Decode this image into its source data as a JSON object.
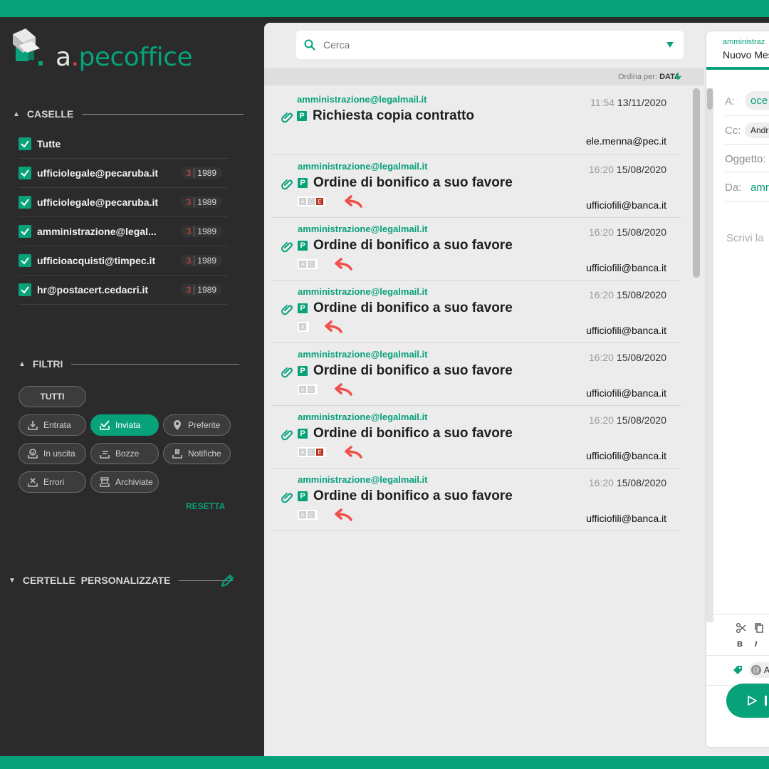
{
  "app": {
    "logo_a": "a",
    "logo_dot": ".",
    "logo_name": "pecoffice"
  },
  "sidebar": {
    "caselle_title": "CASELLE",
    "all_label": "Tutte",
    "mailboxes": [
      {
        "name": "ufficiolegale@pecaruba.it",
        "unread": "3",
        "total": "1989"
      },
      {
        "name": "ufficiolegale@pecaruba.it",
        "unread": "3",
        "total": "1989"
      },
      {
        "name": "amministrazione@legal...",
        "unread": "3",
        "total": "1989"
      },
      {
        "name": "ufficioacquisti@timpec.it",
        "unread": "3",
        "total": "1989"
      },
      {
        "name": "hr@postacert.cedacri.it",
        "unread": "3",
        "total": "1989"
      }
    ],
    "filtri_title": "FILTRI",
    "filters": {
      "tutti": "TUTTI",
      "entrata": "Entrata",
      "inviata": "Inviata",
      "preferite": "Preferite",
      "in_uscita": "In uscita",
      "bozze": "Bozze",
      "notifiche": "Notifiche",
      "errori": "Errori",
      "archiviate": "Archiviate"
    },
    "reset_label": "RESETTA",
    "custom_title": "CERTELLE  PERSONALIZZATE"
  },
  "list": {
    "search_placeholder": "Cerca",
    "sort_label": "Ordina per:",
    "sort_value": "DATA",
    "messages": [
      {
        "from": "amministrazione@legalmail.it",
        "time": "11:54",
        "date": "13/11/2020",
        "subject": "Richiesta copia contratto",
        "to": "ele.menna@pec.it"
      },
      {
        "from": "amministrazione@legalmail.it",
        "time": "16:20",
        "date": "15/08/2020",
        "subject": "Ordine di bonifico a suo favore",
        "to": "ufficiofili@banca.it",
        "tag_a": "A",
        "tag_c": "C",
        "tag_e": "E"
      },
      {
        "from": "amministrazione@legalmail.it",
        "time": "16:20",
        "date": "15/08/2020",
        "subject": "Ordine di bonifico a suo favore",
        "to": "ufficiofili@banca.it",
        "tag_a": "A",
        "tag_c": "C"
      },
      {
        "from": "amministrazione@legalmail.it",
        "time": "16:20",
        "date": "15/08/2020",
        "subject": "Ordine di bonifico a suo favore",
        "to": "ufficiofili@banca.it",
        "tag_a": "A"
      },
      {
        "from": "amministrazione@legalmail.it",
        "time": "16:20",
        "date": "15/08/2020",
        "subject": "Ordine di bonifico a suo favore",
        "to": "ufficiofili@banca.it",
        "tag_a": "A",
        "tag_c": "C"
      },
      {
        "from": "amministrazione@legalmail.it",
        "time": "16:20",
        "date": "15/08/2020",
        "subject": "Ordine di bonifico a suo favore",
        "to": "ufficiofili@banca.it",
        "tag_a": "A",
        "tag_c": "C",
        "tag_e": "E"
      },
      {
        "from": "amministrazione@legalmail.it",
        "time": "16:20",
        "date": "15/08/2020",
        "subject": "Ordine di bonifico a suo favore",
        "to": "ufficiofili@banca.it",
        "tag_a": "A",
        "tag_c": "C"
      }
    ],
    "p_badge": "P"
  },
  "compose": {
    "header_small": "amministraz",
    "header_title": "Nuovo Mes",
    "to_label": "A:",
    "to_value": "oce",
    "cc_label": "Cc:",
    "cc_value": "Andr",
    "subject_label": "Oggetto:",
    "from_label": "Da:",
    "from_value": "amr",
    "body_placeholder": "Scrivi la",
    "bold_label": "B",
    "italic_label": "I",
    "attach_label": "A"
  },
  "colors": {
    "accent": "#07a17a",
    "alert": "#e44a3f",
    "sidebar": "#2b2b2b"
  }
}
